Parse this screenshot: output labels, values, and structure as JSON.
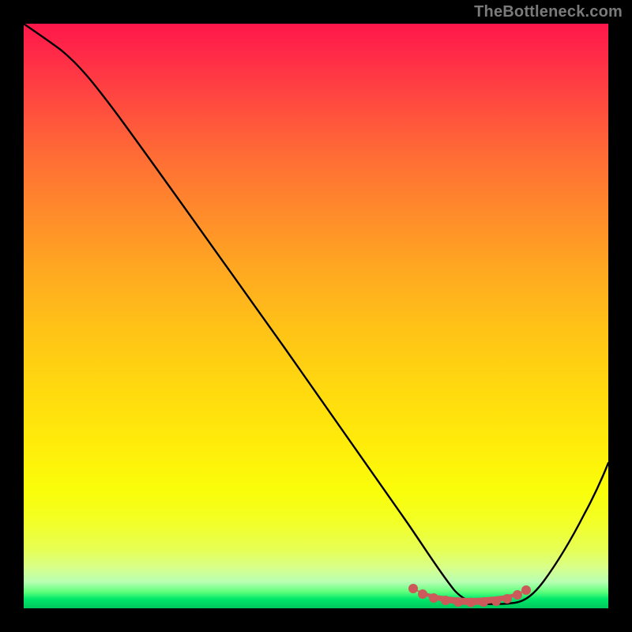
{
  "watermark": "TheBottleneck.com",
  "chart_data": {
    "type": "line",
    "title": "",
    "xlabel": "",
    "ylabel": "",
    "xlim": [
      0,
      100
    ],
    "ylim": [
      0,
      100
    ],
    "series": [
      {
        "name": "bottleneck-curve",
        "x": [
          0,
          6,
          10,
          20,
          30,
          40,
          50,
          60,
          63,
          66,
          70,
          74,
          78,
          82,
          86,
          90,
          95,
          100
        ],
        "values": [
          100,
          97,
          95,
          82,
          67,
          52,
          37,
          21,
          15,
          9,
          4,
          1.5,
          0.7,
          0.7,
          1.5,
          6,
          15,
          27
        ]
      },
      {
        "name": "optimal-zone-marker",
        "x": [
          66,
          69,
          72,
          74,
          76,
          78,
          80,
          82,
          84,
          86
        ],
        "values": [
          2.8,
          2.0,
          1.5,
          1.2,
          1.1,
          1.0,
          1.1,
          1.2,
          1.5,
          2.2
        ]
      }
    ],
    "gradient_stops": [
      {
        "pos": 0,
        "color": "#ff174a"
      },
      {
        "pos": 50,
        "color": "#ffc217"
      },
      {
        "pos": 82,
        "color": "#fafe0a"
      },
      {
        "pos": 97,
        "color": "#5fff7c"
      },
      {
        "pos": 100,
        "color": "#00c85d"
      }
    ],
    "colors": {
      "curve": "#000000",
      "marker": "#cc5a5a",
      "background": "#000000"
    }
  }
}
